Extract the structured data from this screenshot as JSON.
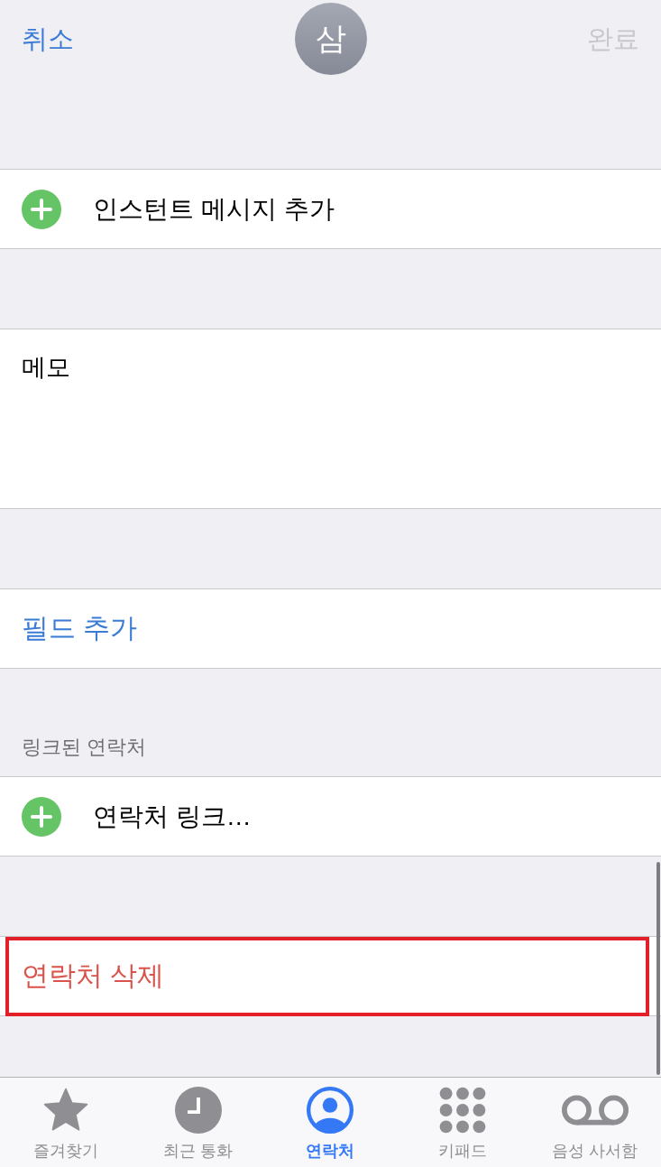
{
  "nav_bar": {
    "cancel": "취소",
    "avatar": "삼",
    "done": {
      "label": "완료",
      "disabled": true
    }
  },
  "sections": [
    {
      "kind": "add",
      "label": "인스턴트 메시지 추가"
    },
    {
      "kind": "memo",
      "label": "메모"
    },
    {
      "kind": "link",
      "label": "필드 추가"
    },
    {
      "kind": "add",
      "header": "링크된 연락처",
      "label": "연락처 링크…"
    },
    {
      "kind": "delete",
      "label": "연락처 삭제",
      "highlighted": true
    }
  ],
  "tab_bar": [
    {
      "label": "즐겨찾기",
      "selected": false
    },
    {
      "label": "최근 통화",
      "selected": false
    },
    {
      "label": "연락처",
      "selected": true
    },
    {
      "label": "키패드",
      "selected": false
    },
    {
      "label": "음성 사서함",
      "selected": false
    }
  ]
}
